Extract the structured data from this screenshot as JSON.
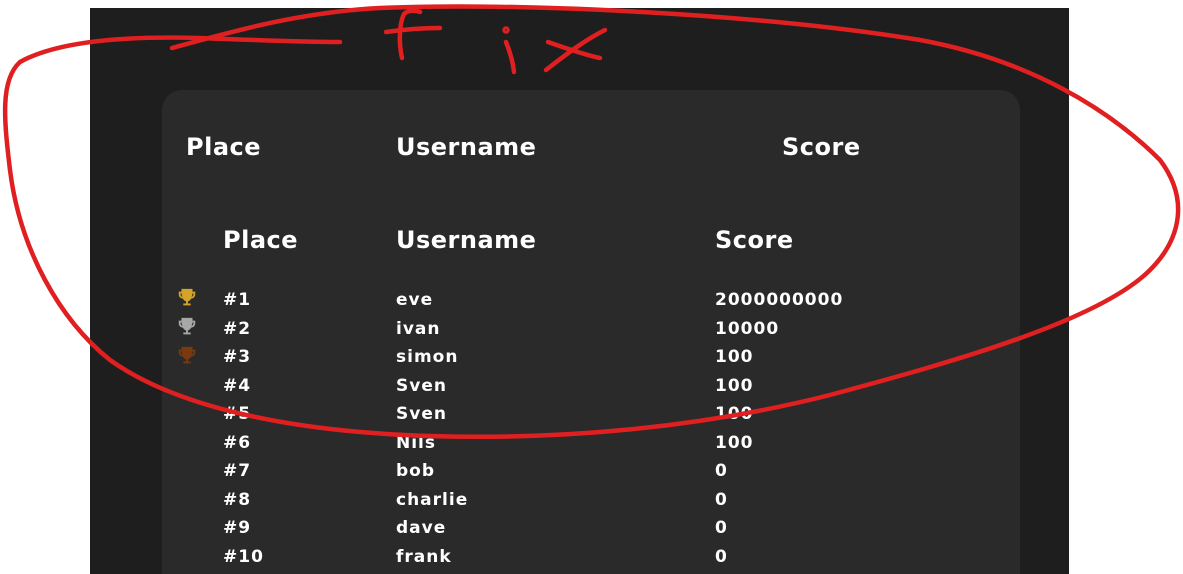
{
  "outer_header": {
    "place": "Place",
    "username": "Username",
    "score": "Score"
  },
  "inner_header": {
    "place": "Place",
    "username": "Username",
    "score": "Score"
  },
  "rows": [
    {
      "place": "#1",
      "username": "eve",
      "score": "2000000000",
      "trophy": "gold-trophy-icon"
    },
    {
      "place": "#2",
      "username": "ivan",
      "score": "10000",
      "trophy": "silver-trophy-icon"
    },
    {
      "place": "#3",
      "username": "simon",
      "score": "100",
      "trophy": "bronze-trophy-icon"
    },
    {
      "place": "#4",
      "username": "Sven",
      "score": "100"
    },
    {
      "place": "#5",
      "username": "Sven",
      "score": "100"
    },
    {
      "place": "#6",
      "username": "Nils",
      "score": "100"
    },
    {
      "place": "#7",
      "username": "bob",
      "score": "0"
    },
    {
      "place": "#8",
      "username": "charlie",
      "score": "0"
    },
    {
      "place": "#9",
      "username": "dave",
      "score": "0"
    },
    {
      "place": "#10",
      "username": "frank",
      "score": "0"
    }
  ],
  "annotation": {
    "text": "Fix",
    "color": "#e02020"
  },
  "colors": {
    "gold": "#d4a42a",
    "silver": "#a8a8a8",
    "bronze": "#7a3a10"
  }
}
